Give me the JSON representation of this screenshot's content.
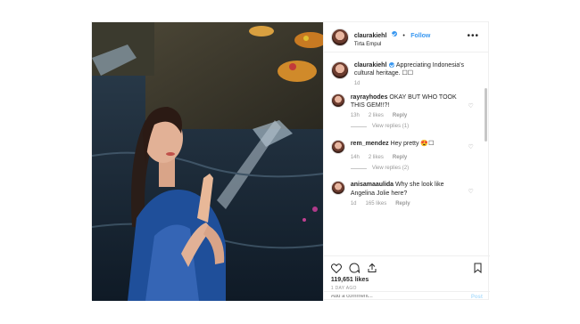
{
  "header": {
    "username": "claurakiehl",
    "follow_label": "Follow",
    "separator": "•",
    "location": "Tirta Empul",
    "more_label": "•••"
  },
  "caption": {
    "username": "claurakiehl",
    "text": "Appreciating Indonesia's cultural heritage. ☐☐",
    "age": "1d"
  },
  "comments": [
    {
      "username": "rayrayhodes",
      "text": "OKAY BUT WHO TOOK THIS GEM!!?!",
      "age": "13h",
      "likes": "2 likes",
      "reply_label": "Reply",
      "view_replies": "View replies (1)"
    },
    {
      "username": "rem_mendez",
      "text": "Hey pretty 😍☐",
      "age": "14h",
      "likes": "2 likes",
      "reply_label": "Reply",
      "view_replies": "View replies (2)"
    },
    {
      "username": "anisamaaulida",
      "text": "Why she look like Angelina Jolie here?",
      "age": "1d",
      "likes": "165 likes",
      "reply_label": "Reply"
    }
  ],
  "footer": {
    "likes": "119,651 likes",
    "time": "1 DAY AGO"
  },
  "add_comment": {
    "placeholder": "Add a comment...",
    "post_label": "Post"
  },
  "colors": {
    "accent": "#3897f0",
    "muted": "#999999",
    "text": "#262626"
  }
}
